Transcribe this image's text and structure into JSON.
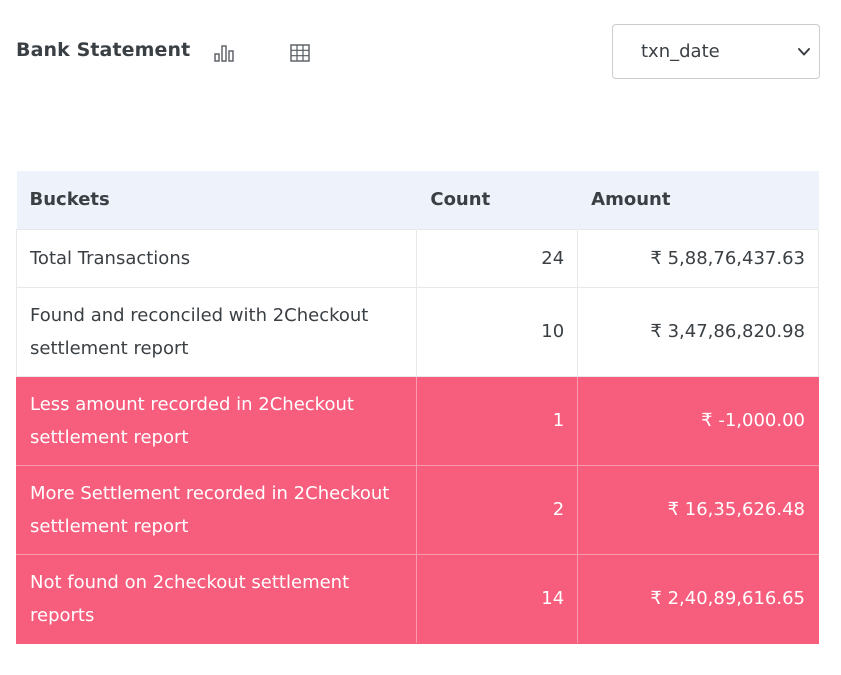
{
  "header": {
    "title": "Bank Statement",
    "chart_icon": "bar-chart-icon",
    "table_icon": "grid-table-icon",
    "select": {
      "selected": "txn_date"
    }
  },
  "table": {
    "columns": [
      "Buckets",
      "Count",
      "Amount"
    ],
    "rows": [
      {
        "bucket": "Total Transactions",
        "count": "24",
        "amount": "₹ 5,88,76,437.63",
        "highlight": false
      },
      {
        "bucket": "Found and reconciled with 2Checkout settlement report",
        "count": "10",
        "amount": "₹ 3,47,86,820.98",
        "highlight": false
      },
      {
        "bucket": "Less amount recorded in 2Checkout settlement report",
        "count": "1",
        "amount": "₹ -1,000.00",
        "highlight": true
      },
      {
        "bucket": "More Settlement recorded in 2Checkout settlement report",
        "count": "2",
        "amount": "₹ 16,35,626.48",
        "highlight": true
      },
      {
        "bucket": "Not found on 2checkout settlement reports",
        "count": "14",
        "amount": "₹ 2,40,89,616.65",
        "highlight": true
      }
    ]
  },
  "colors": {
    "header_bg": "#eef2fa",
    "alert_row": "#f75d7d",
    "text": "#3a3f44"
  }
}
